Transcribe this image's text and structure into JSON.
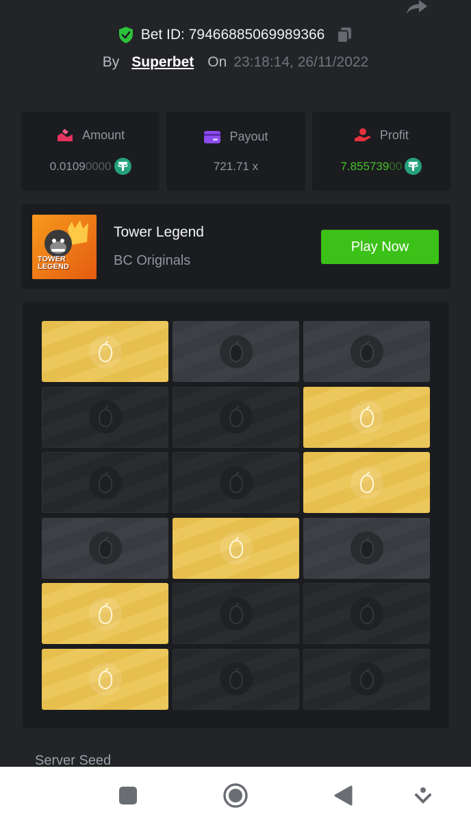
{
  "header": {
    "bet_label": "Bet ID:",
    "bet_id": "79466885069989366",
    "by_label": "By",
    "site": "Superbet",
    "on_label": "On",
    "timestamp": "23:18:14, 26/11/2022"
  },
  "stats": {
    "amount": {
      "label": "Amount",
      "value_main": "0.0109",
      "value_dim": "0000",
      "icon": "amount-icon"
    },
    "payout": {
      "label": "Payout",
      "value": "721.71 x",
      "icon": "card-icon"
    },
    "profit": {
      "label": "Profit",
      "value_main": "7.855739",
      "value_dim": "00",
      "icon": "profit-icon"
    }
  },
  "game": {
    "title": "Tower Legend",
    "provider": "BC Originals",
    "thumb_text_line1": "TOWER",
    "thumb_text_line2": "LEGEND",
    "play_label": "Play Now"
  },
  "board": {
    "rows": [
      [
        "gold",
        "gray",
        "gray"
      ],
      [
        "dark",
        "dark",
        "gold"
      ],
      [
        "dark",
        "dark",
        "gold"
      ],
      [
        "gray",
        "gold",
        "gray"
      ],
      [
        "gold",
        "dark",
        "dark"
      ],
      [
        "gold",
        "dark",
        "dark"
      ]
    ]
  },
  "footer": {
    "server_seed_label": "Server Seed"
  },
  "colors": {
    "background": "#232427",
    "panel": "#1b1c1f",
    "accent_green": "#3bc117",
    "profit_green": "#46c12b",
    "gold_tile": "#e6bf4e",
    "usdt": "#26a17b"
  }
}
